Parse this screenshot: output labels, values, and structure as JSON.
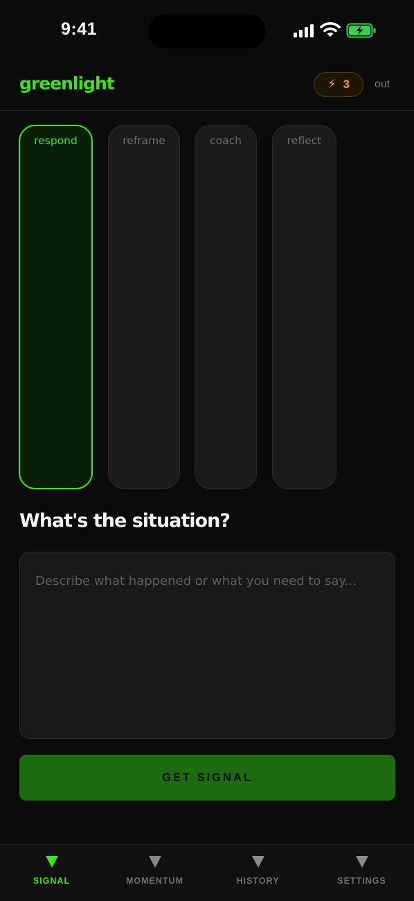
{
  "status_bar": {
    "time": "9:41"
  },
  "header": {
    "logo": "greenlight",
    "energy_count": "3",
    "logout_label": "out"
  },
  "modes": [
    {
      "label": "respond",
      "active": true
    },
    {
      "label": "reframe",
      "active": false
    },
    {
      "label": "coach",
      "active": false
    },
    {
      "label": "reflect",
      "active": false
    }
  ],
  "main": {
    "question": "What's the situation?",
    "input_placeholder": "Describe what happened or what you need to say...",
    "input_value": "",
    "submit_label": "GET SIGNAL"
  },
  "tabs": [
    {
      "label": "SIGNAL",
      "icon": "triangle-down-icon",
      "active": true
    },
    {
      "label": "MOMENTUM",
      "icon": "triangle-down-icon",
      "active": false
    },
    {
      "label": "HISTORY",
      "icon": "triangle-down-icon",
      "active": false
    },
    {
      "label": "SETTINGS",
      "icon": "triangle-down-icon",
      "active": false
    }
  ],
  "colors": {
    "accent": "#39e51c",
    "energy": "#f4a126",
    "button": "#1d6d10",
    "background": "#0b0b0b"
  }
}
